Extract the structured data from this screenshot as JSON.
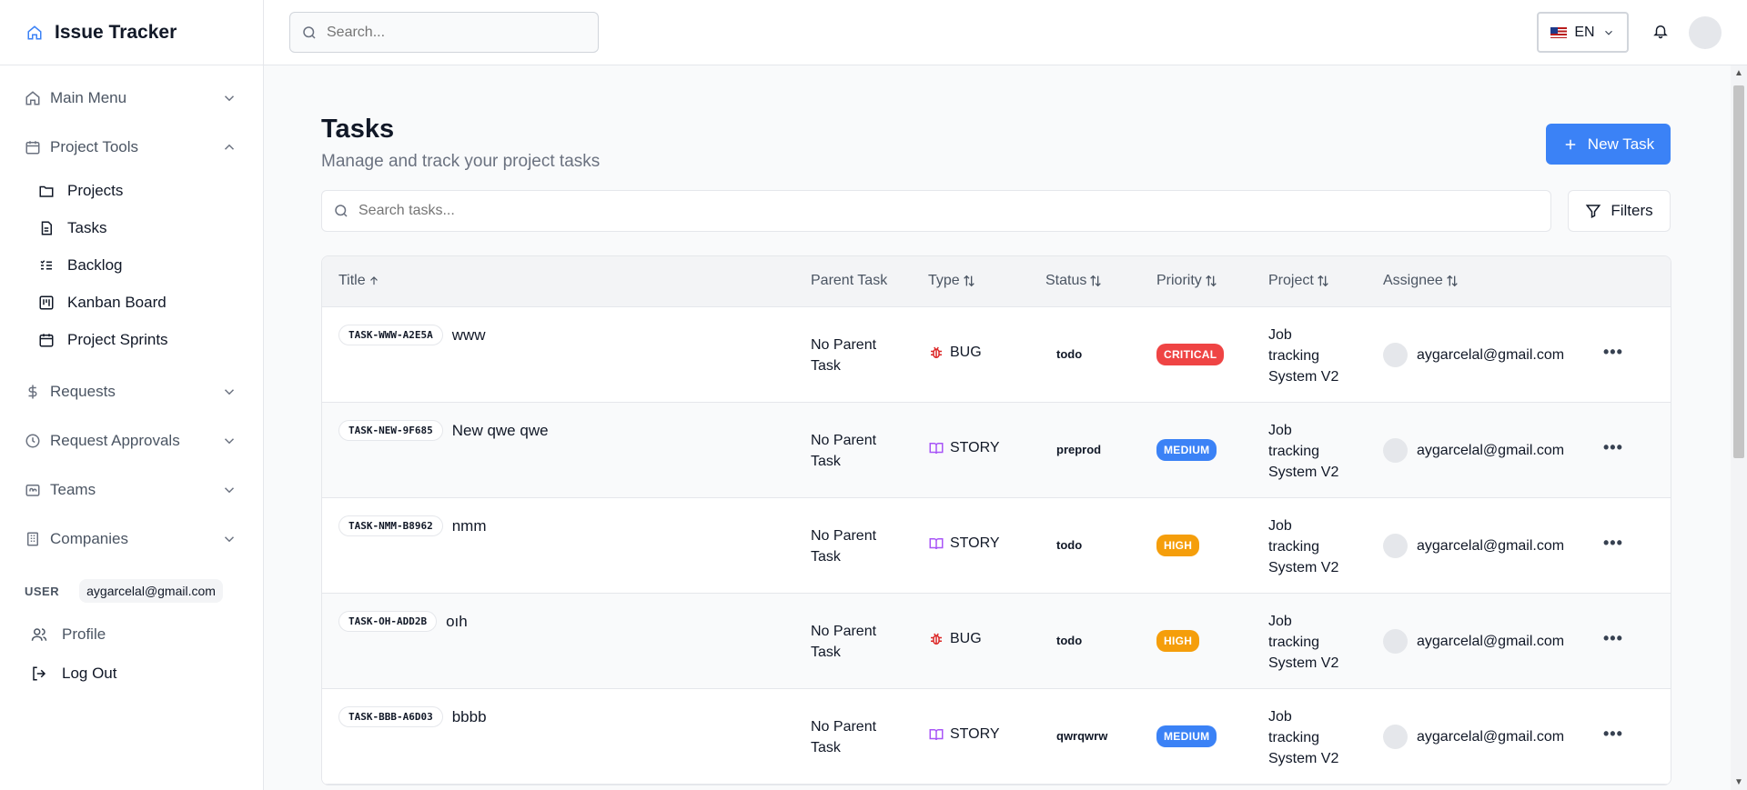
{
  "app": {
    "title": "Issue Tracker"
  },
  "header": {
    "search_placeholder": "Search...",
    "language": "EN"
  },
  "sidebar": {
    "sections": [
      {
        "label": "Main Menu",
        "icon": "home-icon",
        "expanded": false
      },
      {
        "label": "Project Tools",
        "icon": "calendar-icon",
        "expanded": true
      }
    ],
    "project_tools_items": [
      {
        "label": "Projects",
        "icon": "folder-icon"
      },
      {
        "label": "Tasks",
        "icon": "file-icon"
      },
      {
        "label": "Backlog",
        "icon": "list-check-icon"
      },
      {
        "label": "Kanban Board",
        "icon": "kanban-icon"
      },
      {
        "label": "Project Sprints",
        "icon": "calendar-icon"
      }
    ],
    "more_sections": [
      {
        "label": "Requests",
        "icon": "dollar-icon"
      },
      {
        "label": "Request Approvals",
        "icon": "clock-icon"
      },
      {
        "label": "Teams",
        "icon": "team-icon"
      },
      {
        "label": "Companies",
        "icon": "building-icon"
      }
    ],
    "user_tag": "USER",
    "user_email": "aygarcelal@gmail.com",
    "profile_label": "Profile",
    "logout_label": "Log Out"
  },
  "main": {
    "title": "Tasks",
    "subtitle": "Manage and track your project tasks",
    "new_task_label": "New Task",
    "search_placeholder": "Search tasks...",
    "filters_label": "Filters",
    "columns": {
      "title": "Title",
      "parent": "Parent Task",
      "type": "Type",
      "status": "Status",
      "priority": "Priority",
      "project": "Project",
      "assignee": "Assignee"
    },
    "rows": [
      {
        "code": "TASK-WWW-A2E5A",
        "name": "www",
        "parent_l1": "No Parent",
        "parent_l2": "Task",
        "type": "BUG",
        "status": "todo",
        "priority": "CRITICAL",
        "project_l1": "Job",
        "project_l2": "tracking",
        "project_l3": "System V2",
        "assignee": "aygarcelal@gmail.com"
      },
      {
        "code": "TASK-NEW-9F685",
        "name": "New qwe qwe",
        "parent_l1": "No Parent",
        "parent_l2": "Task",
        "type": "STORY",
        "status": "preprod",
        "priority": "MEDIUM",
        "project_l1": "Job",
        "project_l2": "tracking",
        "project_l3": "System V2",
        "assignee": "aygarcelal@gmail.com"
      },
      {
        "code": "TASK-NMM-B8962",
        "name": "nmm",
        "parent_l1": "No Parent",
        "parent_l2": "Task",
        "type": "STORY",
        "status": "todo",
        "priority": "HIGH",
        "project_l1": "Job",
        "project_l2": "tracking",
        "project_l3": "System V2",
        "assignee": "aygarcelal@gmail.com"
      },
      {
        "code": "TASK-OH-ADD2B",
        "name": "oıh",
        "parent_l1": "No Parent",
        "parent_l2": "Task",
        "type": "BUG",
        "status": "todo",
        "priority": "HIGH",
        "project_l1": "Job",
        "project_l2": "tracking",
        "project_l3": "System V2",
        "assignee": "aygarcelal@gmail.com"
      },
      {
        "code": "TASK-BBB-A6D03",
        "name": "bbbb",
        "parent_l1": "No Parent",
        "parent_l2": "Task",
        "type": "STORY",
        "status": "qwrqwrw",
        "priority": "MEDIUM",
        "project_l1": "Job",
        "project_l2": "tracking",
        "project_l3": "System V2",
        "assignee": "aygarcelal@gmail.com"
      }
    ]
  },
  "colors": {
    "accent": "#3b82f6",
    "critical": "#ef4444",
    "medium": "#3b82f6",
    "high": "#f59e0b",
    "bug": "#dc2626",
    "story": "#a855f7"
  }
}
